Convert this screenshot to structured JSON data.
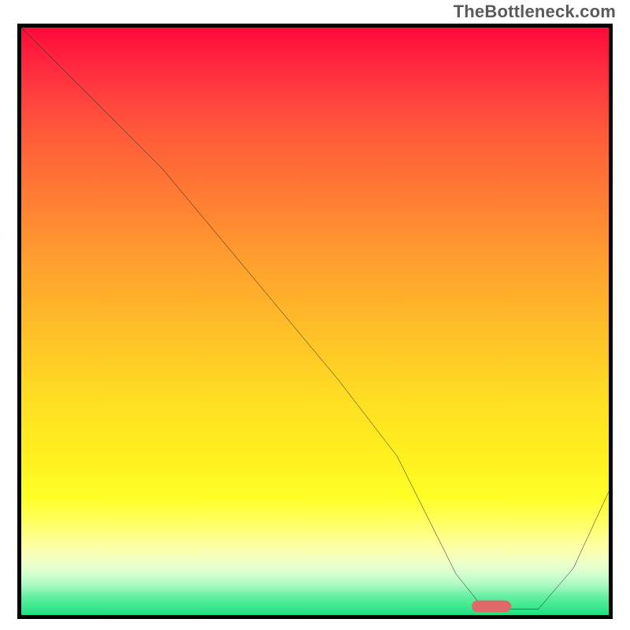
{
  "watermark_text": "TheBottleneck.com",
  "chart_data": {
    "type": "line",
    "title": "",
    "xlabel": "",
    "ylabel": "",
    "xlim": [
      0,
      100
    ],
    "ylim": [
      0,
      100
    ],
    "series": [
      {
        "name": "bottleneck-curve",
        "x": [
          0,
          8,
          20,
          24,
          34,
          44,
          54,
          64,
          70,
          74,
          78,
          82,
          88,
          94,
          100
        ],
        "y": [
          100,
          92,
          80,
          76,
          64,
          52,
          40,
          27,
          15,
          7,
          2,
          1,
          1,
          8,
          21
        ]
      }
    ],
    "marker": {
      "name": "optimal-range",
      "x": 80,
      "y": 1.5,
      "color": "#e06868"
    },
    "gradient_stops": [
      {
        "pos": 0,
        "color": "#ff0a3a"
      },
      {
        "pos": 50,
        "color": "#ffc028"
      },
      {
        "pos": 80,
        "color": "#ffff28"
      },
      {
        "pos": 100,
        "color": "#1ee27e"
      }
    ]
  }
}
